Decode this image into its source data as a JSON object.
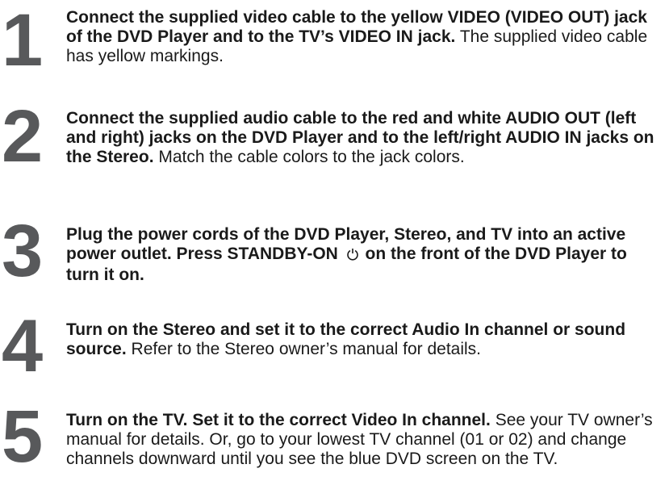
{
  "steps": [
    {
      "number": "1",
      "bold": "Connect the supplied video cable to the yellow VIDEO (VIDEO OUT) jack of the DVD Player and to the TV’s VIDEO IN jack.",
      "normal": "The supplied video cable has yellow markings."
    },
    {
      "number": "2",
      "bold": "Connect the supplied audio cable to the red and white AUDIO OUT (left and right) jacks on the DVD Player and to the left/right AUDIO IN jacks on the Stereo.",
      "normal": "Match the cable colors to the jack colors."
    },
    {
      "number": "3",
      "bold_before_icon": "Plug the power cords of the DVD Player, Stereo, and TV into an active power outlet. Press STANDBY-ON",
      "icon": "standby-power-icon",
      "bold_after_icon": "on the front of the DVD Player to turn it on."
    },
    {
      "number": "4",
      "bold": "Turn on the Stereo and set it to the correct Audio In channel or sound source.",
      "normal": "Refer to the Stereo owner’s manual for details."
    },
    {
      "number": "5",
      "bold": "Turn on the TV. Set it to the correct Video In channel.",
      "normal": "See your TV owner’s manual for details. Or, go to your lowest TV channel (01 or 02) and change channels downward until you see the blue DVD screen on the TV."
    }
  ],
  "colors": {
    "step_number": "#58595b",
    "text": "#1a1a1a"
  }
}
